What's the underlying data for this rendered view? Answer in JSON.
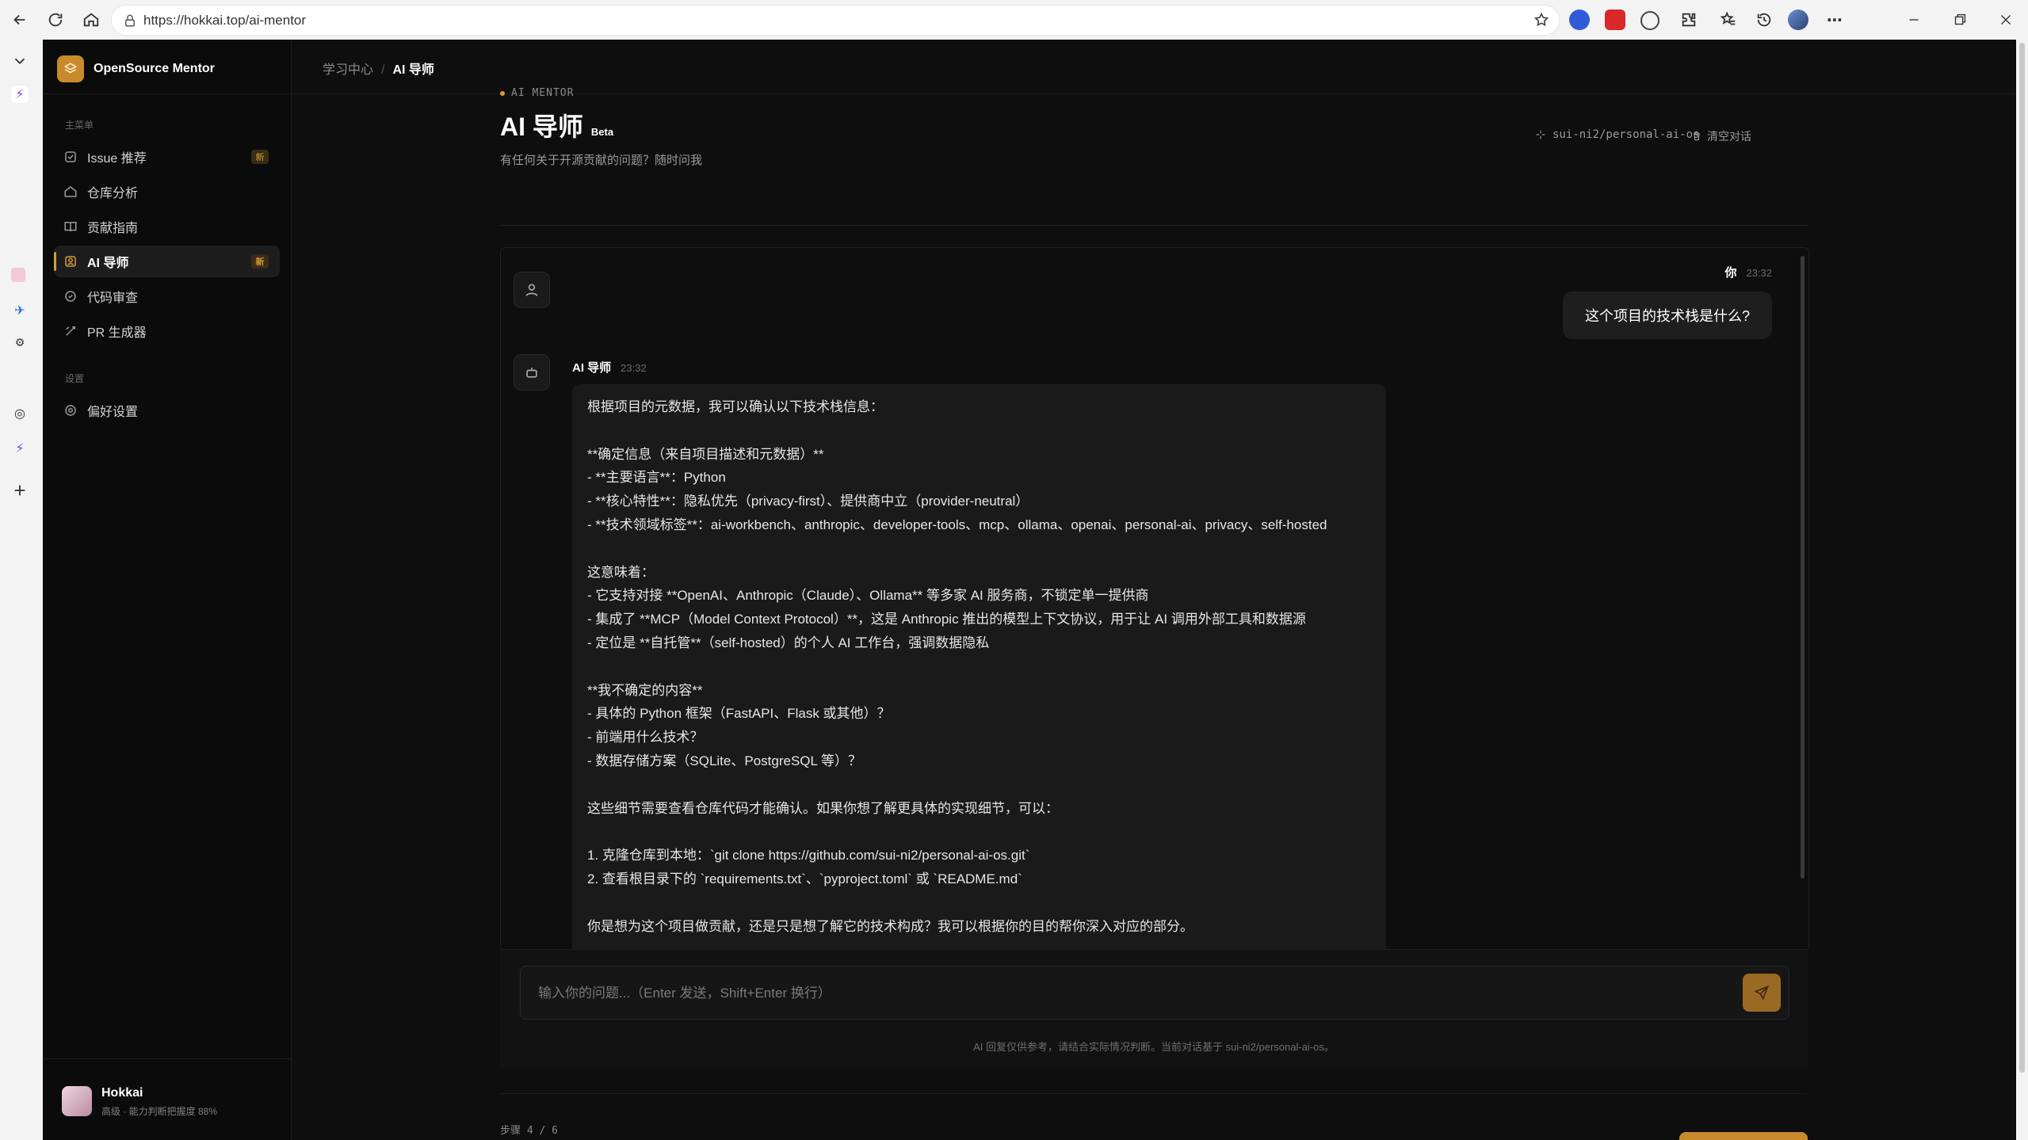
{
  "browser": {
    "url": "https://hokkai.top/ai-mentor"
  },
  "app": {
    "brand": "OpenSource Mentor",
    "sections": {
      "main": "主菜单",
      "settings": "设置"
    },
    "nav": [
      {
        "label": "Issue 推荐",
        "badge": "新",
        "icon": "check-square-icon"
      },
      {
        "label": "仓库分析",
        "icon": "home-icon"
      },
      {
        "label": "贡献指南",
        "icon": "book-icon"
      },
      {
        "label": "AI 导师",
        "badge": "新",
        "icon": "mentor-icon",
        "active": true
      },
      {
        "label": "代码审查",
        "icon": "review-icon"
      },
      {
        "label": "PR 生成器",
        "icon": "pr-icon"
      }
    ],
    "settings_nav": [
      {
        "label": "偏好设置",
        "icon": "gear-icon"
      }
    ],
    "user": {
      "name": "Hokkai",
      "level": "高级 · 能力判断把握度 88%"
    }
  },
  "breadcrumb": {
    "root": "学习中心",
    "sep": "/",
    "current": "AI 导师"
  },
  "header": {
    "eyebrow": "AI MENTOR",
    "title": "AI 导师",
    "badge": "Beta",
    "subtitle": "有任何关于开源贡献的问题？随时问我",
    "repo": "sui-ni2/personal-ai-os",
    "clear": "清空对话"
  },
  "chat": {
    "user_message": {
      "sender": "你",
      "time": "23:32",
      "text": "这个项目的技术栈是什么?"
    },
    "ai_message": {
      "sender": "AI 导师",
      "time": "23:32",
      "text": "根据项目的元数据，我可以确认以下技术栈信息：\n\n**确定信息（来自项目描述和元数据）**\n- **主要语言**：Python\n- **核心特性**：隐私优先（privacy-first）、提供商中立（provider-neutral）\n- **技术领域标签**：ai-workbench、anthropic、developer-tools、mcp、ollama、openai、personal-ai、privacy、self-hosted\n\n这意味着：\n- 它支持对接 **OpenAI、Anthropic（Claude）、Ollama** 等多家 AI 服务商，不锁定单一提供商\n- 集成了 **MCP（Model Context Protocol）**，这是 Anthropic 推出的模型上下文协议，用于让 AI 调用外部工具和数据源\n- 定位是 **自托管**（self-hosted）的个人 AI 工作台，强调数据隐私\n\n**我不确定的内容**\n- 具体的 Python 框架（FastAPI、Flask 或其他）？\n- 前端用什么技术？\n- 数据存储方案（SQLite、PostgreSQL 等）？\n\n这些细节需要查看仓库代码才能确认。如果你想了解更具体的实现细节，可以：\n\n1. 克隆仓库到本地：`git clone https://github.com/sui-ni2/personal-ai-os.git`\n2. 查看根目录下的 `requirements.txt`、`pyproject.toml` 或 `README.md`\n\n你是想为这个项目做贡献，还是只是想了解它的技术构成？我可以根据你的目的帮你深入对应的部分。"
    }
  },
  "input": {
    "placeholder": "输入你的问题...（Enter 发送，Shift+Enter 换行）",
    "value": "",
    "disclaimer": "AI 回复仅供参考，请结合实际情况判断。当前对话基于 sui-ni2/personal-ai-os。"
  },
  "footer": {
    "step": "步骤 4 / 6"
  },
  "colors": {
    "accent": "#d79a3a",
    "background": "#0e0e0e"
  }
}
